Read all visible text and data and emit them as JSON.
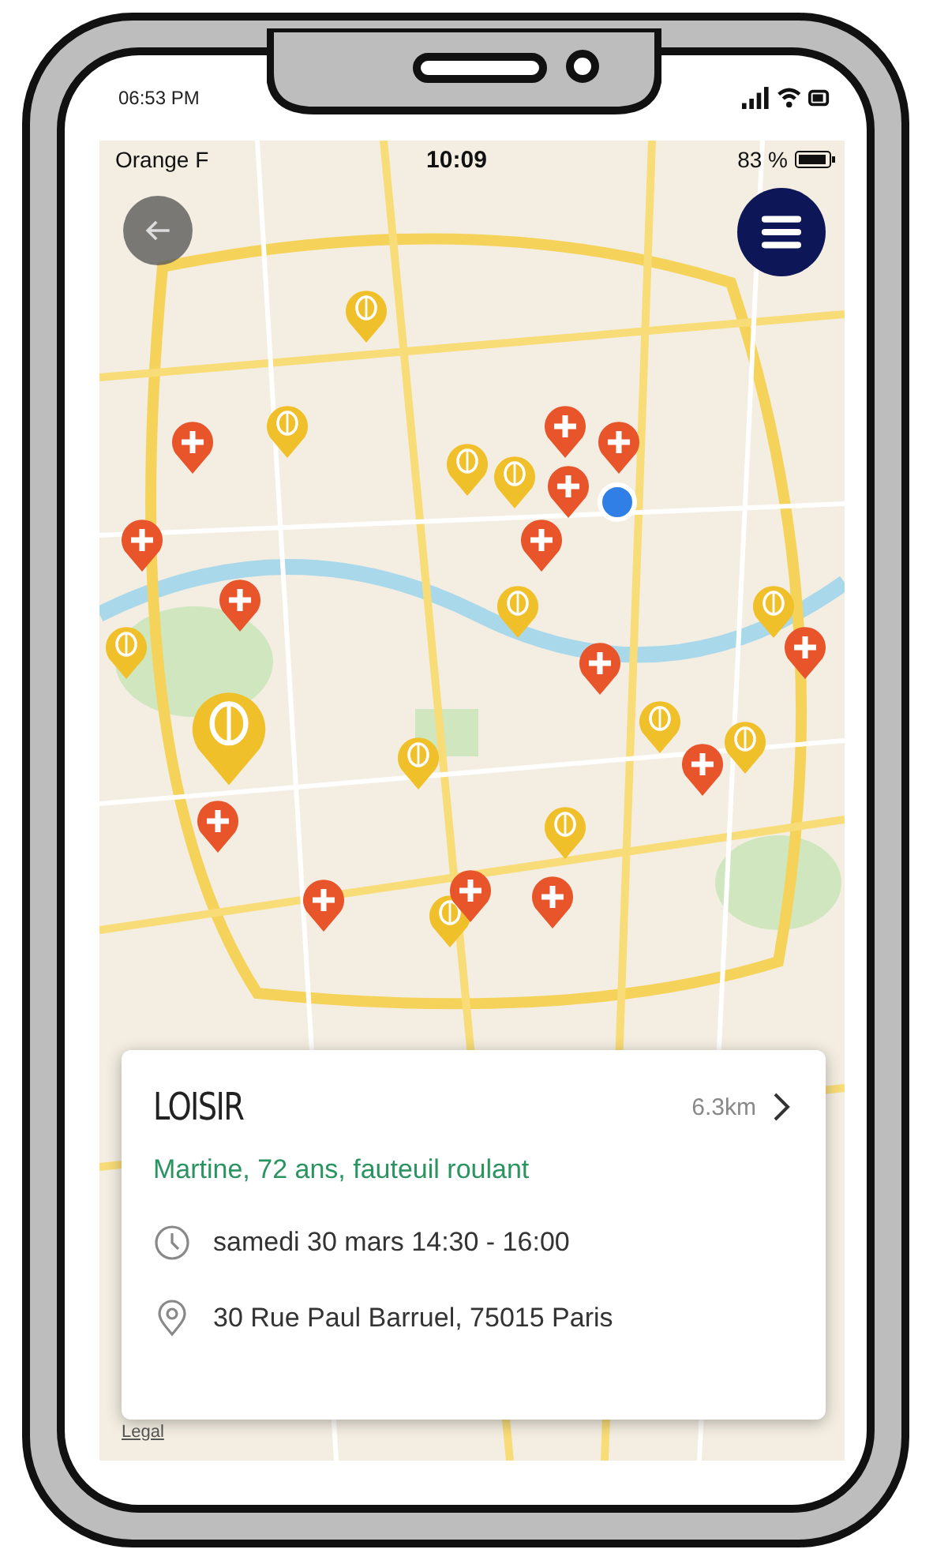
{
  "phone_status": {
    "time": "06:53 PM"
  },
  "status_bar": {
    "carrier": "Orange F",
    "time": "10:09",
    "battery": "83 %"
  },
  "map": {
    "pins": [
      {
        "kind": "leisure"
      },
      {
        "kind": "leisure"
      },
      {
        "kind": "leisure"
      },
      {
        "kind": "leisure"
      },
      {
        "kind": "leisure"
      },
      {
        "kind": "leisure"
      },
      {
        "kind": "leisure"
      },
      {
        "kind": "leisure"
      },
      {
        "kind": "leisure"
      },
      {
        "kind": "leisure"
      },
      {
        "kind": "leisure"
      },
      {
        "kind": "leisure"
      },
      {
        "kind": "care"
      },
      {
        "kind": "care"
      },
      {
        "kind": "care"
      },
      {
        "kind": "care"
      },
      {
        "kind": "care"
      },
      {
        "kind": "care"
      },
      {
        "kind": "care"
      },
      {
        "kind": "care"
      },
      {
        "kind": "care"
      },
      {
        "kind": "care"
      },
      {
        "kind": "care"
      },
      {
        "kind": "care"
      },
      {
        "kind": "care"
      },
      {
        "kind": "care"
      },
      {
        "kind": "leisure_large"
      }
    ],
    "legal_link": "Legal"
  },
  "event_card": {
    "category": "LOISIR",
    "distance": "6.3km",
    "person": "Martine, 72 ans, fauteuil roulant",
    "schedule": "samedi 30 mars 14:30 - 16:00",
    "address": "30 Rue Paul Barruel, 75015 Paris"
  }
}
